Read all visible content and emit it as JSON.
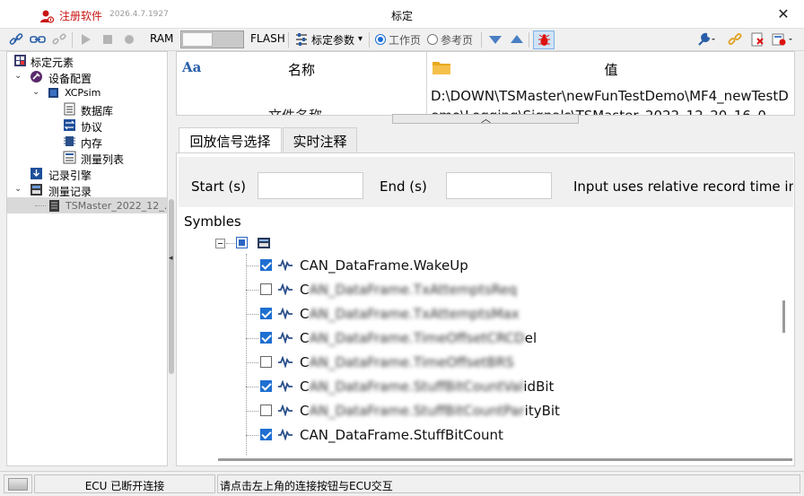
{
  "titlebar": {
    "register_label": "注册软件",
    "version": "2026.4.7.1927",
    "title": "标定",
    "close_glyph": "✕"
  },
  "toolbar": {
    "ram_label": "RAM",
    "flash_label": "FLASH",
    "calib_params_label": "标定参数",
    "dropdown_glyph": "▾",
    "radio_working_page": "工作页",
    "radio_reference_page": "参考页",
    "working_page_selected": true,
    "ram_selected": true,
    "icons": [
      "link-icon",
      "connect-icon",
      "disconnect-icon",
      "play-icon",
      "stop-icon",
      "record-icon",
      "download-icon",
      "upload-icon",
      "debug-bug-icon",
      "wrench-icon",
      "chain-icon",
      "clear-icon",
      "settings-icon"
    ]
  },
  "tree": {
    "items": [
      {
        "label": "标定元素",
        "icon": "calibration-root-icon"
      },
      {
        "label": "设备配置",
        "icon": "device-config-icon"
      },
      {
        "label": "XCPsim",
        "icon": "ecu-chip-icon"
      },
      {
        "label": "数据库",
        "icon": "database-icon"
      },
      {
        "label": "协议",
        "icon": "protocol-icon"
      },
      {
        "label": "内存",
        "icon": "memory-icon"
      },
      {
        "label": "测量列表",
        "icon": "measure-list-icon"
      },
      {
        "label": "记录引擎",
        "icon": "record-engine-icon"
      },
      {
        "label": "测量记录",
        "icon": "measure-record-icon"
      },
      {
        "label": "TSMaster_2022_12_...",
        "icon": "record-file-icon"
      }
    ]
  },
  "propgrid": {
    "header_name": "名称",
    "header_value": "值",
    "row_name": "文件名称",
    "row_value": "D:\\DOWN\\TSMaster\\newFunTestDemo\\MF4_newTestDemo\\Logging\\Signals\\TSMaster_2022_12_20_16_0"
  },
  "tabs": [
    {
      "label": "回放信号选择",
      "active": true
    },
    {
      "label": "实时注释",
      "active": false
    }
  ],
  "filter": {
    "start_label": "Start (s)",
    "end_label": "End (s)",
    "start_value": "",
    "end_value": "",
    "hint": "Input uses relative record time in"
  },
  "symbles": {
    "label": "Symbles",
    "signals": [
      {
        "prefix": "CAN_DataFrame.WakeUp",
        "blurred": "",
        "suffix": "",
        "checked": true
      },
      {
        "prefix": "C",
        "blurred": "AN_DataFrame.TxAttemptsReq",
        "suffix": "",
        "checked": false
      },
      {
        "prefix": "C",
        "blurred": "AN_DataFrame.TxAttemptsMax",
        "suffix": "",
        "checked": true
      },
      {
        "prefix": "C",
        "blurred": "AN_DataFrame.TimeOffsetCRCD",
        "suffix": "el",
        "checked": true
      },
      {
        "prefix": "C",
        "blurred": "AN_DataFrame.TimeOffsetBRS",
        "suffix": "",
        "checked": false
      },
      {
        "prefix": "C",
        "blurred": "AN_DataFrame.StuffBitCountVal",
        "suffix": "idBit",
        "checked": true
      },
      {
        "prefix": "C",
        "blurred": "AN_DataFrame.StuffBitCountPar",
        "suffix": "ityBit",
        "checked": false
      },
      {
        "prefix": "CAN_DataFrame.StuffBitCount",
        "blurred": "",
        "suffix": "",
        "checked": true
      }
    ]
  },
  "statusbar": {
    "ecu_status": "ECU 已断开连接",
    "hint": "请点击左上角的连接按钮与ECU交互"
  },
  "colors": {
    "accent_blue": "#1f6fd1",
    "register_red": "#c81414",
    "selection_gray": "#d9d9d9"
  }
}
